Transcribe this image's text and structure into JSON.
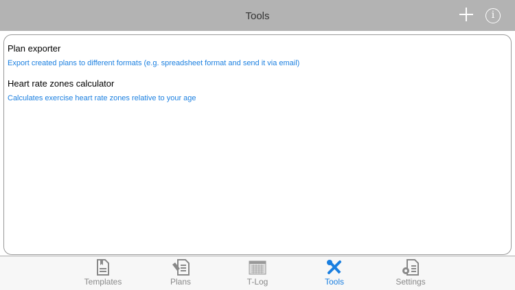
{
  "header": {
    "title": "Tools",
    "add_icon": "plus-icon",
    "info_icon": "info-icon",
    "info_glyph": "i"
  },
  "tools": [
    {
      "title": "Plan exporter",
      "description": "Export created plans to different formats (e.g. spreadsheet format and send it via email)"
    },
    {
      "title": "Heart rate zones calculator",
      "description": "Calculates exercise heart rate zones relative to your age"
    }
  ],
  "tabs": [
    {
      "label": "Templates",
      "icon": "templates-icon"
    },
    {
      "label": "Plans",
      "icon": "plans-icon"
    },
    {
      "label": "T-Log",
      "icon": "calendar-icon"
    },
    {
      "label": "Tools",
      "icon": "tools-icon",
      "active": true
    },
    {
      "label": "Settings",
      "icon": "settings-icon"
    }
  ],
  "colors": {
    "accent": "#1a7fe0",
    "header": "#b3b3b3"
  }
}
